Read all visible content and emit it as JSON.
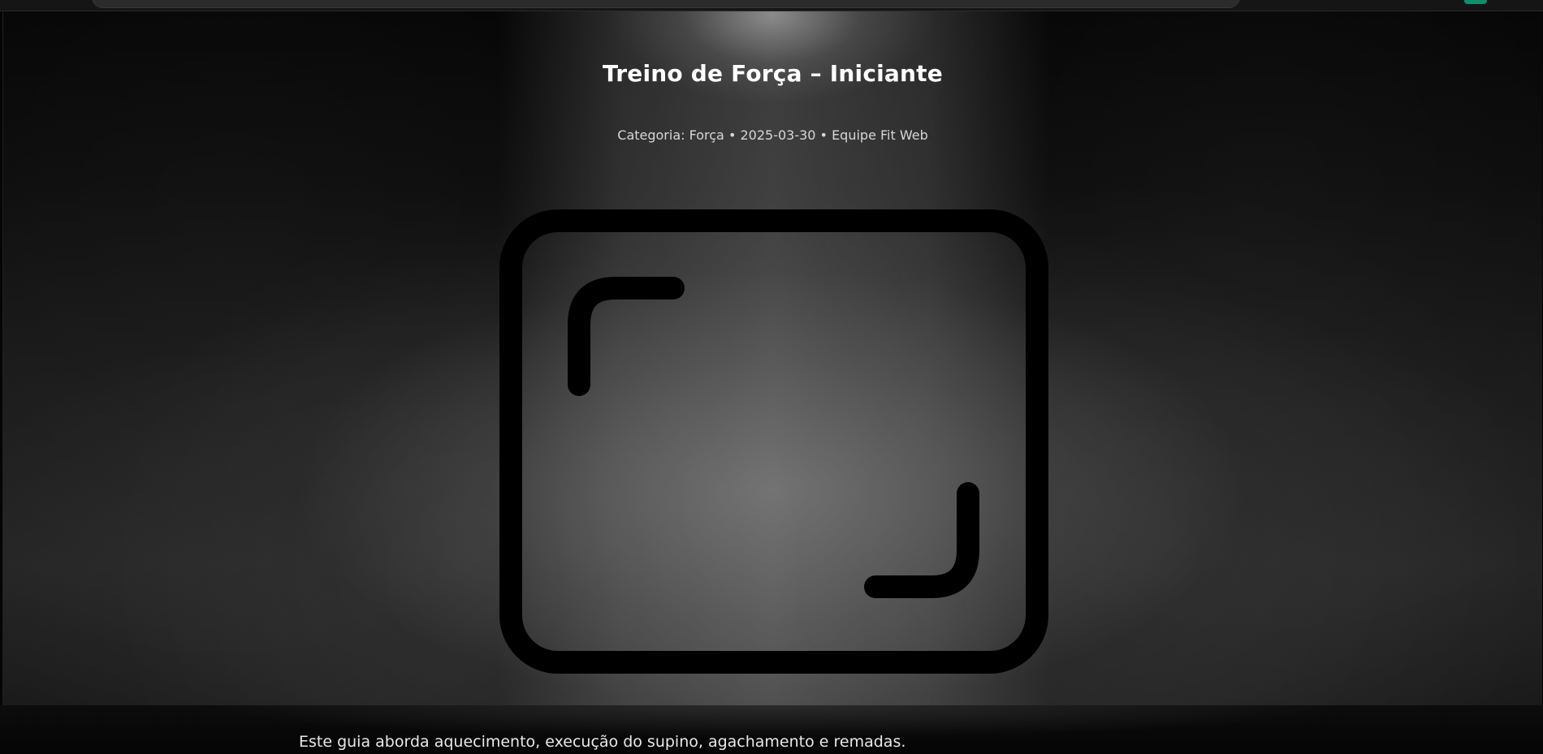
{
  "article": {
    "title": "Treino de Força – Iniciante",
    "meta": "Categoria: Força • 2025-03-30 • Equipe Fit Web",
    "hero_icon": "image-placeholder-icon",
    "intro": "Este guia aborda aquecimento, execução do supino, agachamento e remadas."
  },
  "colors": {
    "background": "#050505",
    "title": "#ffffff",
    "meta": "#d7d7d7",
    "icon_stroke": "#000000",
    "accent": "#0f8f6a"
  }
}
